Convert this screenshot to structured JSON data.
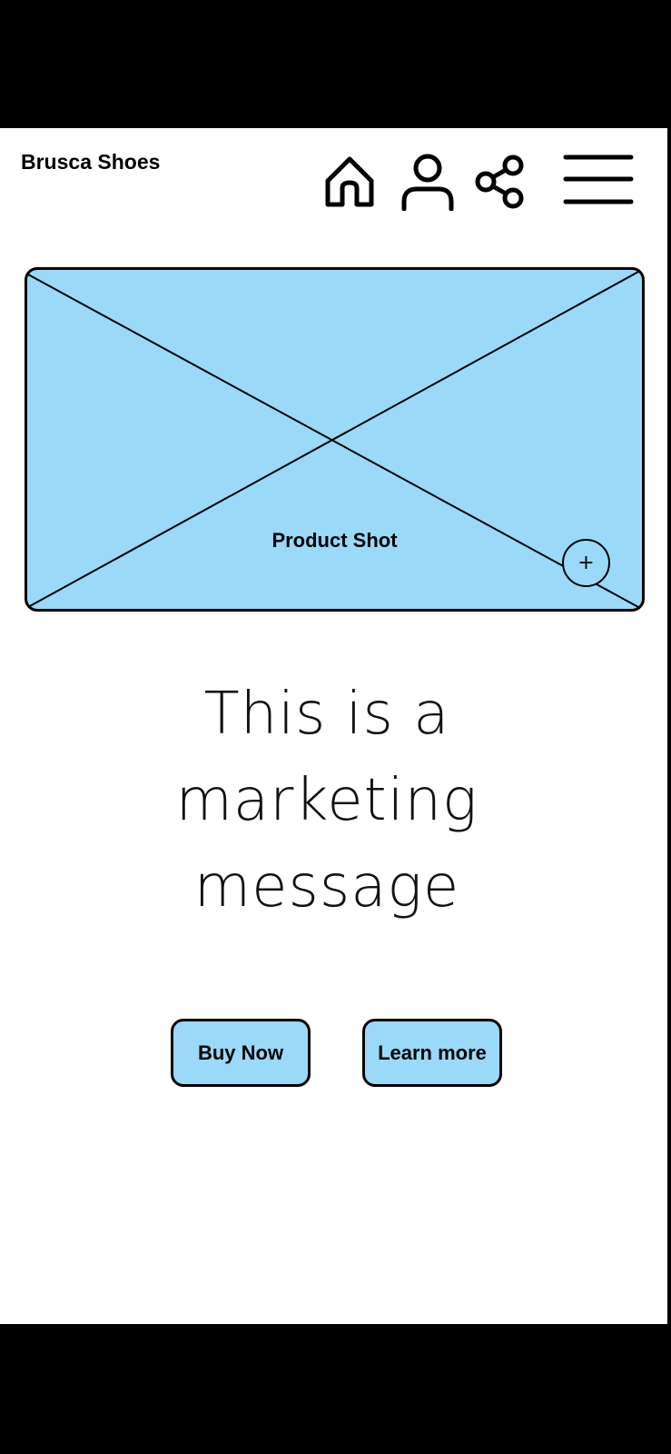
{
  "header": {
    "brand": "Brusca Shoes",
    "icons": [
      "home-icon",
      "user-icon",
      "share-icon",
      "hamburger-menu-icon"
    ]
  },
  "hero": {
    "caption": "Product Shot",
    "zoom_symbol": "+"
  },
  "marketing": {
    "lines": [
      "This is a",
      "marketing",
      "message"
    ]
  },
  "actions": {
    "buy_label": "Buy Now",
    "learn_label": "Learn more"
  },
  "colors": {
    "accent": "#9ad9f8",
    "ink": "#000000",
    "background": "#ffffff"
  }
}
